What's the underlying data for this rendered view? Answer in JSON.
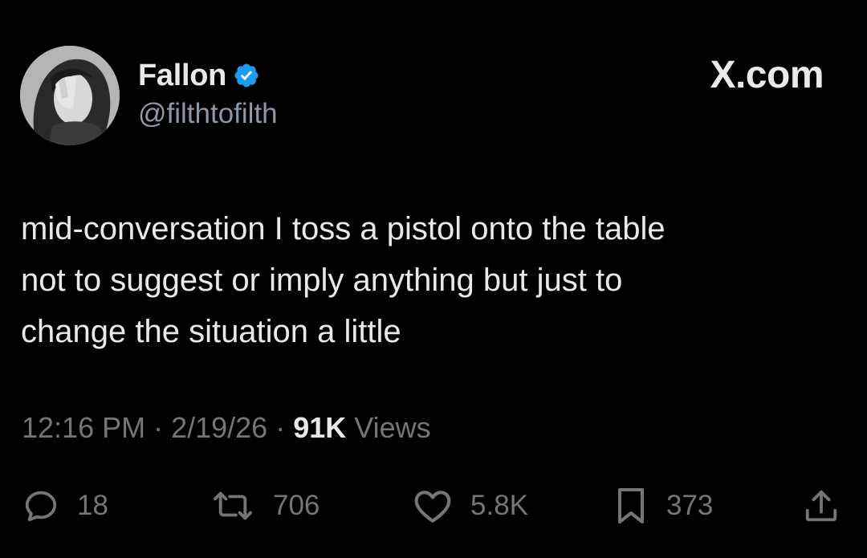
{
  "author": {
    "display_name": "Fallon",
    "handle": "@filthtofilth",
    "verified_icon": "verified-badge-icon",
    "verified_color": "#1d9bf0"
  },
  "brand": "X.com",
  "tweet": {
    "lines": [
      "mid-conversation I toss a pistol onto the table",
      "not to suggest or imply anything but just to",
      "change the situation a little"
    ]
  },
  "meta": {
    "time": "12:16 PM",
    "separator": "·",
    "date": "2/19/26",
    "views_count": "91K",
    "views_label": "Views"
  },
  "actions": {
    "replies": {
      "icon": "reply-icon",
      "count": "18"
    },
    "retweets": {
      "icon": "retweet-icon",
      "count": "706"
    },
    "likes": {
      "icon": "heart-icon",
      "count": "5.8K"
    },
    "bookmarks": {
      "icon": "bookmark-icon",
      "count": "373"
    },
    "share": {
      "icon": "share-icon"
    }
  },
  "colors": {
    "background": "#000000",
    "text_primary": "#e7e9ea",
    "text_secondary": "#71767b"
  }
}
